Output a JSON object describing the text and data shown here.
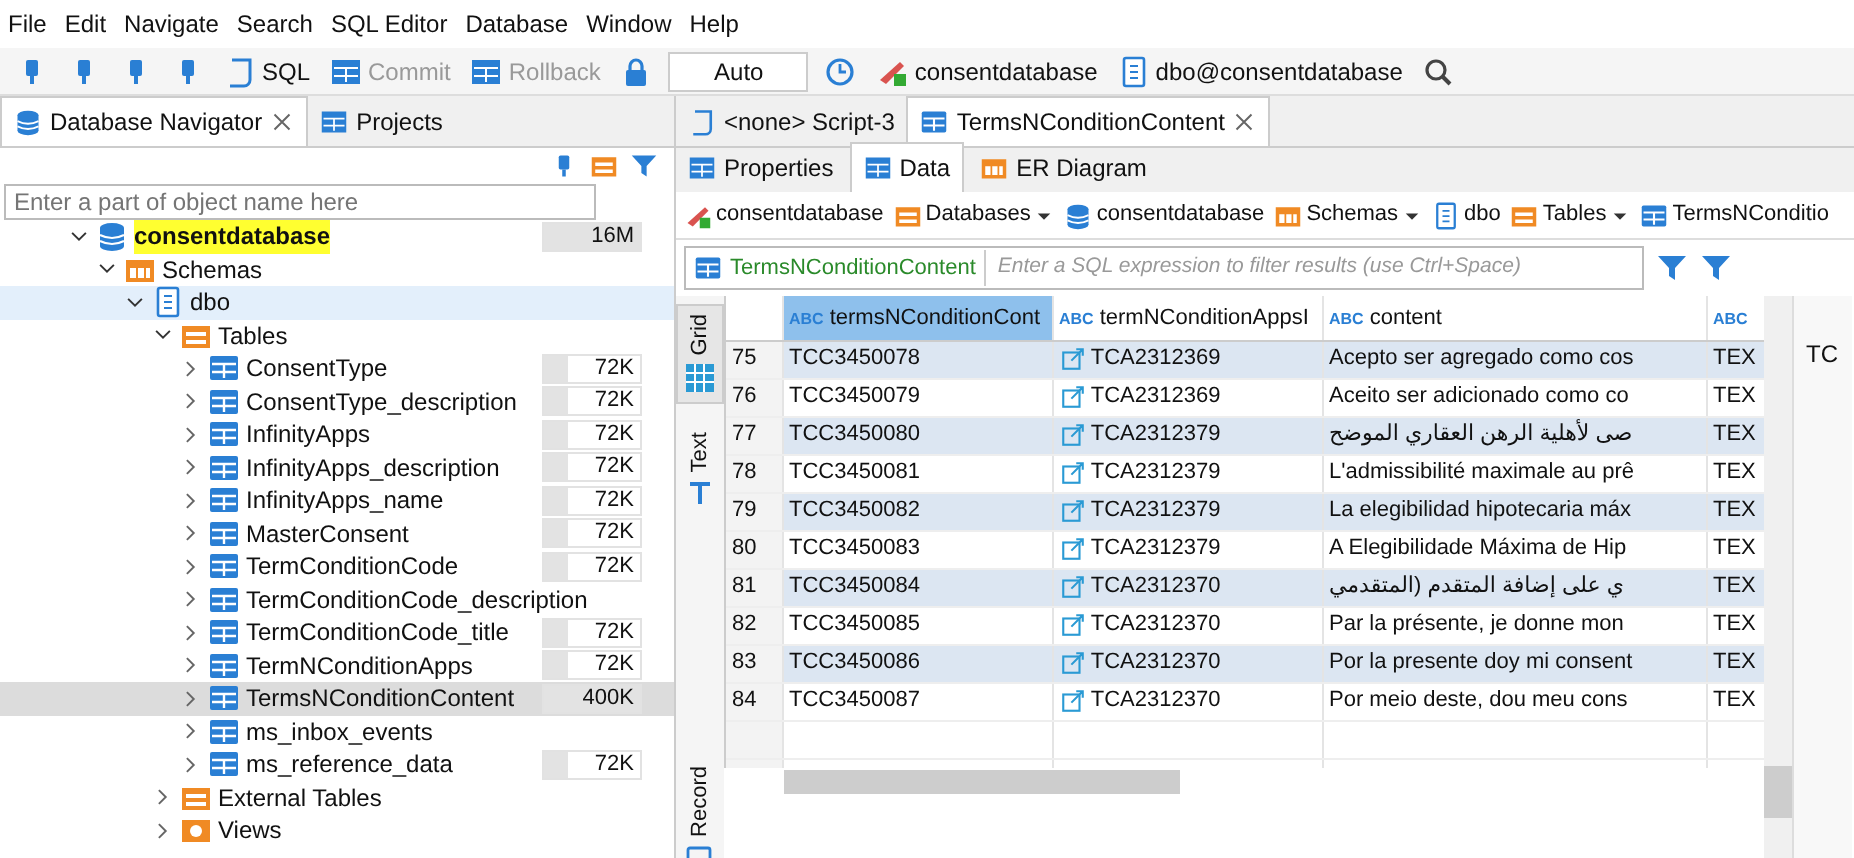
{
  "menu": [
    "File",
    "Edit",
    "Navigate",
    "Search",
    "SQL Editor",
    "Database",
    "Window",
    "Help"
  ],
  "toolbar": [
    {
      "kind": "icon"
    },
    {
      "kind": "icon"
    },
    {
      "kind": "icon"
    },
    {
      "kind": "icon"
    },
    {
      "kind": "button",
      "label": "SQL",
      "disabled": false
    },
    {
      "kind": "button",
      "label": "Commit",
      "disabled": true
    },
    {
      "kind": "button",
      "label": "Rollback",
      "disabled": true
    },
    {
      "kind": "icon"
    },
    {
      "kind": "field",
      "label": "Auto"
    },
    {
      "kind": "icon"
    },
    {
      "kind": "button",
      "label": "consentdatabase",
      "disabled": false
    },
    {
      "kind": "button",
      "label": "dbo@consentdatabase",
      "disabled": false
    },
    {
      "kind": "icon"
    }
  ],
  "navigator": {
    "tabs": [
      {
        "label": "Database Navigator",
        "selected": true
      },
      {
        "label": "Projects",
        "selected": false
      }
    ],
    "filter": {
      "placeholder": "Enter a part of object name here"
    },
    "tree": [
      {
        "label": "consentdatabase",
        "kind": "database",
        "size": "16M",
        "expanded": true,
        "selected": false,
        "children": [
          {
            "label": "Schemas",
            "kind": "schemas",
            "expanded": true,
            "selected": false,
            "children": [
              {
                "label": "dbo",
                "kind": "schema",
                "expanded": true,
                "selected": true,
                "children": [
                  {
                    "label": "Tables",
                    "kind": "folder",
                    "expanded": true,
                    "selected": false,
                    "children": [
                      {
                        "label": "ConsentType",
                        "kind": "table",
                        "size": "72K",
                        "expanded": false,
                        "selected": false
                      },
                      {
                        "label": "ConsentType_description",
                        "kind": "table",
                        "size": "72K",
                        "expanded": false,
                        "selected": false
                      },
                      {
                        "label": "InfinityApps",
                        "kind": "table",
                        "size": "72K",
                        "expanded": false,
                        "selected": false
                      },
                      {
                        "label": "InfinityApps_description",
                        "kind": "table",
                        "size": "72K",
                        "expanded": false,
                        "selected": false
                      },
                      {
                        "label": "InfinityApps_name",
                        "kind": "table",
                        "size": "72K",
                        "expanded": false,
                        "selected": false
                      },
                      {
                        "label": "MasterConsent",
                        "kind": "table",
                        "size": "72K",
                        "expanded": false,
                        "selected": false
                      },
                      {
                        "label": "TermConditionCode",
                        "kind": "table",
                        "size": "72K",
                        "expanded": false,
                        "selected": false
                      },
                      {
                        "label": "TermConditionCode_description",
                        "kind": "table",
                        "expanded": false,
                        "selected": false
                      },
                      {
                        "label": "TermConditionCode_title",
                        "kind": "table",
                        "size": "72K",
                        "expanded": false,
                        "selected": false
                      },
                      {
                        "label": "TermNConditionApps",
                        "kind": "table",
                        "size": "72K",
                        "expanded": false,
                        "selected": false
                      },
                      {
                        "label": "TermsNConditionContent",
                        "kind": "table",
                        "size": "400K",
                        "expanded": false,
                        "selected": false,
                        "hovered": true
                      },
                      {
                        "label": "ms_inbox_events",
                        "kind": "table",
                        "expanded": false,
                        "selected": false
                      },
                      {
                        "label": "ms_reference_data",
                        "kind": "table",
                        "size": "72K",
                        "expanded": false,
                        "selected": false
                      }
                    ]
                  },
                  {
                    "label": "External Tables",
                    "kind": "folder",
                    "expanded": false,
                    "selected": false
                  },
                  {
                    "label": "Views",
                    "kind": "views",
                    "expanded": false,
                    "selected": false
                  }
                ]
              }
            ]
          }
        ]
      }
    ]
  },
  "editor": {
    "tabs": [
      {
        "label": "<none> Script-3",
        "selected": false
      },
      {
        "label": "TermsNConditionContent",
        "selected": true
      }
    ],
    "subtabs": [
      {
        "label": "Properties",
        "selected": false
      },
      {
        "label": "Data",
        "selected": true
      },
      {
        "label": "ER Diagram",
        "selected": false
      }
    ],
    "breadcrumb": [
      {
        "label": "consentdatabase",
        "kind": "connection",
        "dropdown": false
      },
      {
        "label": "Databases",
        "kind": "folder",
        "dropdown": true
      },
      {
        "label": "consentdatabase",
        "kind": "database",
        "dropdown": false
      },
      {
        "label": "Schemas",
        "kind": "schemas",
        "dropdown": true
      },
      {
        "label": "dbo",
        "kind": "schema",
        "dropdown": false
      },
      {
        "label": "Tables",
        "kind": "folder",
        "dropdown": true
      },
      {
        "label": "TermsNConditio",
        "kind": "table"
      }
    ],
    "filter": {
      "table": "TermsNConditionContent",
      "placeholder": "Enter a SQL expression to filter results (use Ctrl+Space)"
    },
    "side_tabs": [
      {
        "label": "Grid",
        "selected": true
      },
      {
        "label": "Text",
        "selected": false
      },
      {
        "label": "Record",
        "selected": false
      }
    ],
    "table": {
      "columns": [
        {
          "type": "ABC",
          "name": "termsNConditionCont",
          "selected": true
        },
        {
          "type": "ABC",
          "name": "termNConditionAppsI",
          "selected": false
        },
        {
          "type": "ABC",
          "name": "content",
          "selected": false
        },
        {
          "type": "ABC",
          "selected": false
        }
      ],
      "rows": [
        {
          "number": "75",
          "cells": [
            "TCC3450078",
            "TCA2312369",
            "Acepto ser agregado como cos",
            "TEX"
          ]
        },
        {
          "number": "76",
          "cells": [
            "TCC3450079",
            "TCA2312369",
            "Aceito ser adicionado como co",
            "TEX"
          ]
        },
        {
          "number": "77",
          "cells": [
            "TCC3450080",
            "TCA2312379",
            "صى لأهلية الرهن العقاري الموضح",
            "TEX"
          ]
        },
        {
          "number": "78",
          "cells": [
            "TCC3450081",
            "TCA2312379",
            "L'admissibilité maximale au prê",
            "TEX"
          ]
        },
        {
          "number": "79",
          "cells": [
            "TCC3450082",
            "TCA2312379",
            "La elegibilidad hipotecaria máx",
            "TEX"
          ]
        },
        {
          "number": "80",
          "cells": [
            "TCC3450083",
            "TCA2312379",
            "A Elegibilidade Máxima de Hip",
            "TEX"
          ]
        },
        {
          "number": "81",
          "cells": [
            "TCC3450084",
            "TCA2312370",
            "ي على إضافة المتقدم (المتقدمي",
            "TEX"
          ]
        },
        {
          "number": "82",
          "cells": [
            "TCC3450085",
            "TCA2312370",
            "Par la présente, je donne mon",
            "TEX"
          ]
        },
        {
          "number": "83",
          "cells": [
            "TCC3450086",
            "TCA2312370",
            "Por la presente doy mi consent",
            "TEX"
          ]
        },
        {
          "number": "84",
          "cells": [
            "TCC3450087",
            "TCA2312370",
            "Por meio deste, dou meu cons",
            "TEX"
          ]
        }
      ]
    }
  },
  "side_panel": {
    "text": "TC"
  }
}
